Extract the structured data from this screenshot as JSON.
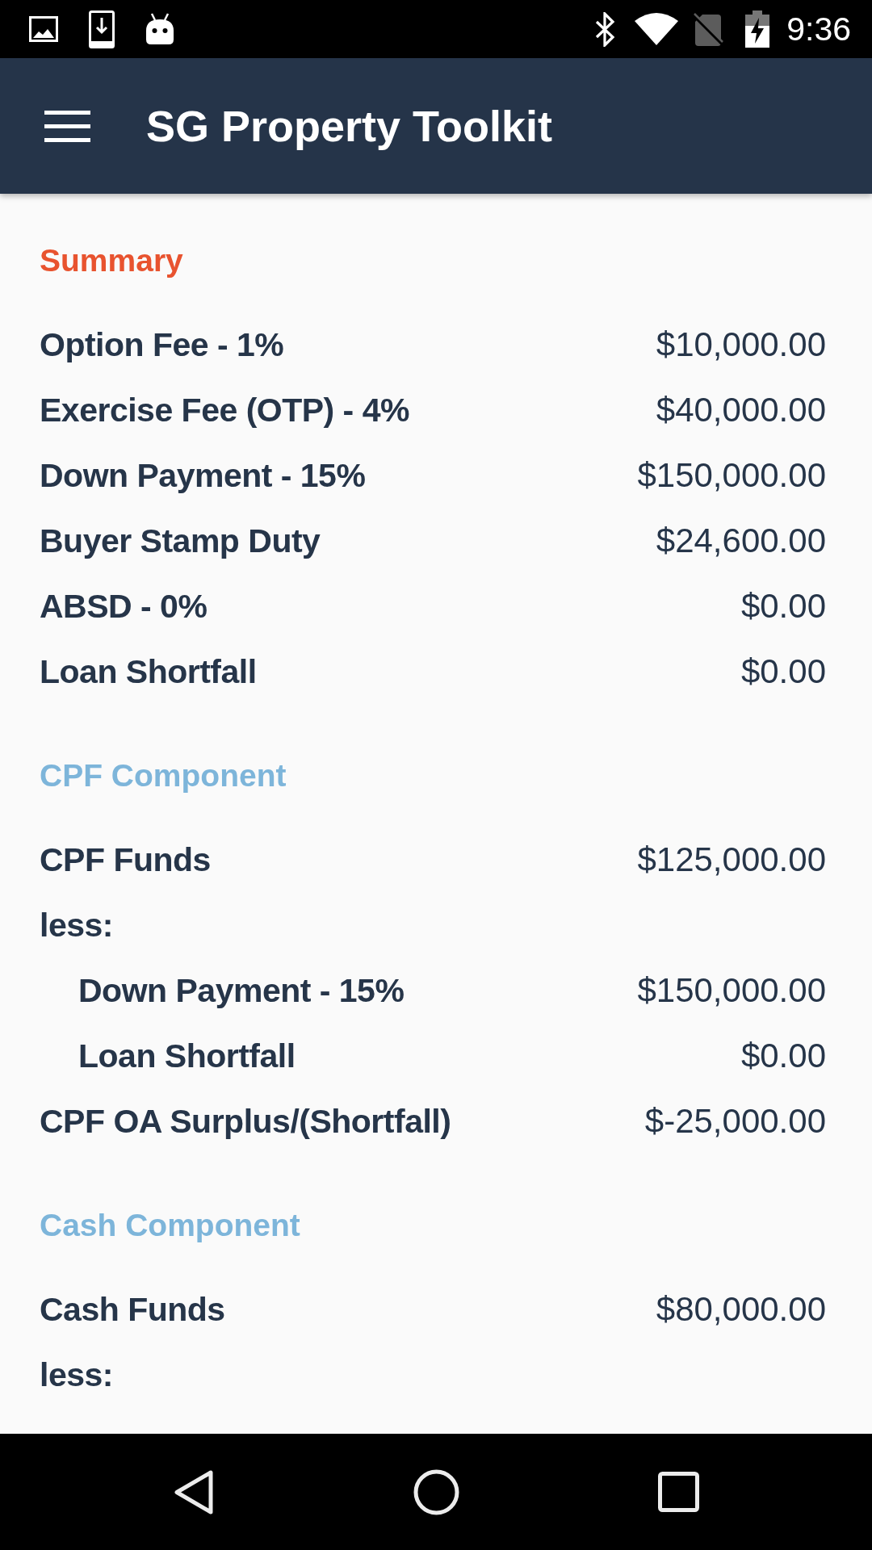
{
  "status_bar": {
    "time": "9:36"
  },
  "app_bar": {
    "title": "SG Property Toolkit"
  },
  "sections": [
    {
      "title": "Summary",
      "color": "#e8532f",
      "rows": [
        {
          "label": "Option Fee - 1%",
          "value": "$10,000.00"
        },
        {
          "label": "Exercise Fee (OTP) - 4%",
          "value": "$40,000.00"
        },
        {
          "label": "Down Payment - 15%",
          "value": "$150,000.00"
        },
        {
          "label": "Buyer Stamp Duty",
          "value": "$24,600.00"
        },
        {
          "label": "ABSD - 0%",
          "value": "$0.00"
        },
        {
          "label": "Loan Shortfall",
          "value": "$0.00"
        }
      ]
    },
    {
      "title": "CPF Component",
      "color": "#7db5da",
      "rows": [
        {
          "label": "CPF Funds",
          "value": "$125,000.00"
        },
        {
          "label": "less:",
          "children": [
            {
              "label": "Down Payment - 15%",
              "value": "$150,000.00"
            },
            {
              "label": "Loan Shortfall",
              "value": "$0.00"
            }
          ]
        },
        {
          "label": "CPF OA Surplus/(Shortfall)",
          "value": "$-25,000.00"
        }
      ]
    },
    {
      "title": "Cash Component",
      "color": "#7db5da",
      "rows": [
        {
          "label": "Cash Funds",
          "value": "$80,000.00"
        },
        {
          "label": "less:"
        }
      ]
    }
  ]
}
